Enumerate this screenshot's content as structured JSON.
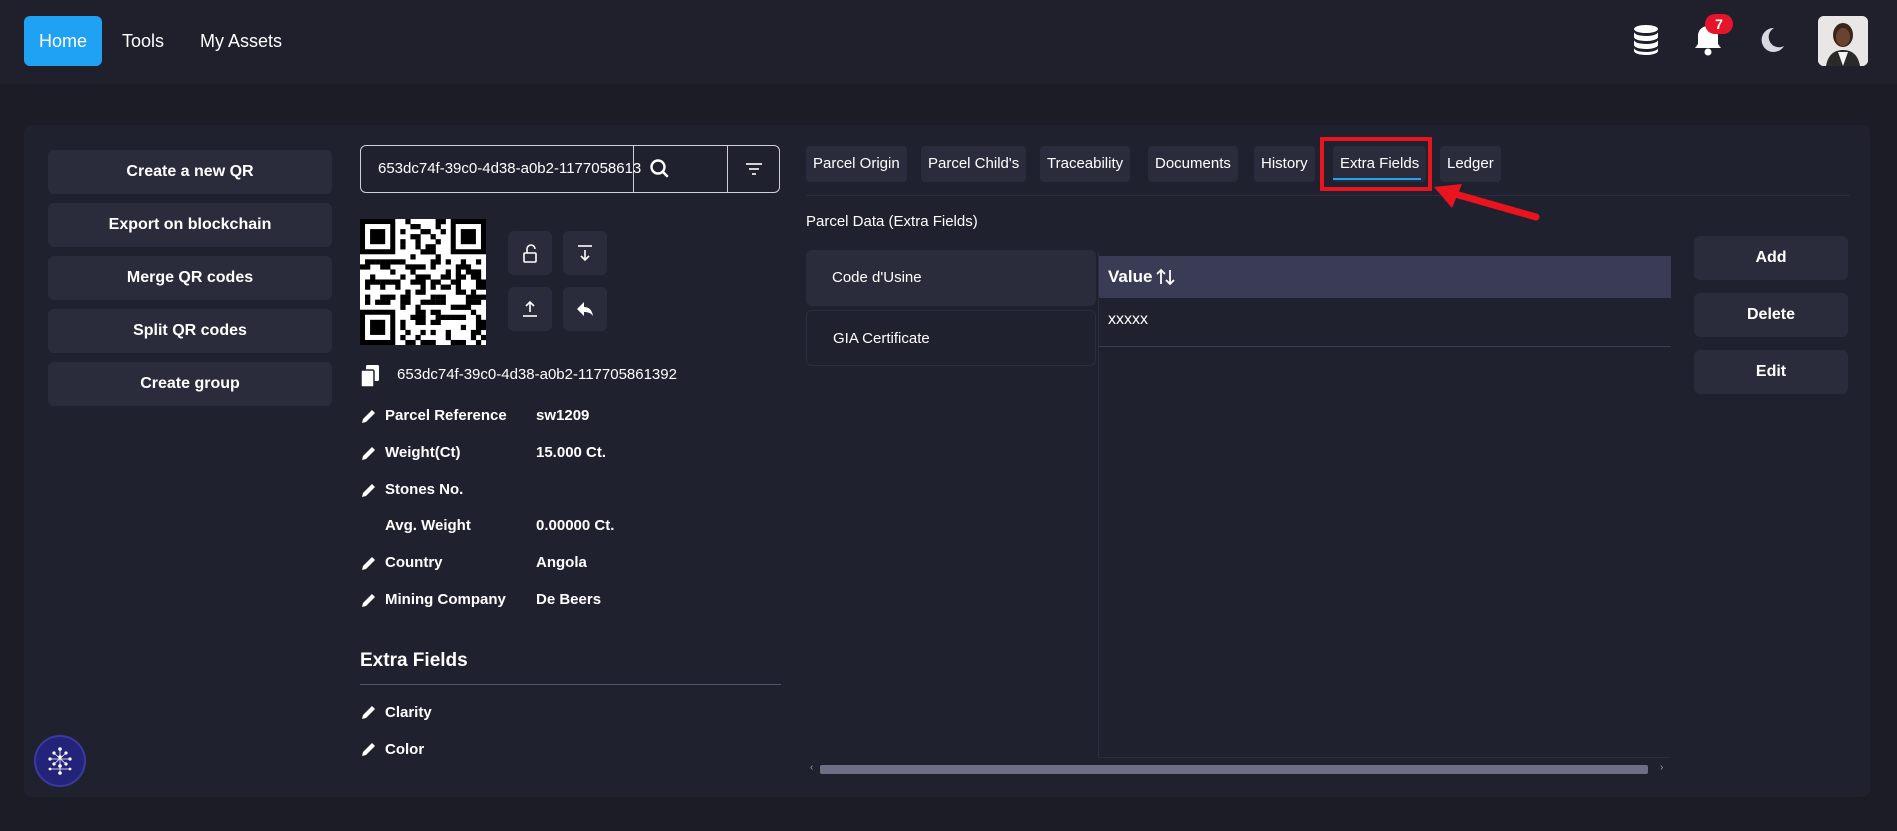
{
  "nav": {
    "home": "Home",
    "tools": "Tools",
    "assets": "My Assets",
    "notification_count": "7",
    "icons": [
      "database-icon",
      "bell-icon",
      "moon-icon"
    ]
  },
  "sidebar": {
    "buttons": [
      "Create a new QR",
      "Export on blockchain",
      "Merge QR codes",
      "Split QR codes",
      "Create group"
    ]
  },
  "search": {
    "value": "653dc74f-39c0-4d38-a0b2-1177058613"
  },
  "parcel": {
    "uuid": "653dc74f-39c0-4d38-a0b2-117705861392",
    "fields": [
      {
        "label": "Parcel Reference",
        "value": "sw1209"
      },
      {
        "label": "Weight(Ct)",
        "value": "15.000 Ct."
      },
      {
        "label": "Stones No.",
        "value": ""
      },
      {
        "label": "Avg. Weight",
        "value": "0.00000 Ct."
      },
      {
        "label": "Country",
        "value": "Angola"
      },
      {
        "label": "Mining Company",
        "value": "De Beers"
      }
    ]
  },
  "extra_fields": {
    "title": "Extra Fields",
    "items": [
      "Clarity",
      "Color"
    ]
  },
  "tabs": [
    "Parcel Origin",
    "Parcel Child's",
    "Traceability",
    "Documents",
    "History",
    "Extra Fields",
    "Ledger"
  ],
  "active_tab": "Extra Fields",
  "content": {
    "section_label": "Parcel Data (Extra Fields)",
    "list": [
      "Code d'Usine",
      "GIA Certificate"
    ],
    "table_header": "Value",
    "table_value": "xxxxx"
  },
  "actions": {
    "add": "Add",
    "delete": "Delete",
    "edit": "Edit"
  },
  "colors": {
    "accent": "#1fa1f4",
    "badge": "#e5152b",
    "highlight": "#e8141e"
  }
}
